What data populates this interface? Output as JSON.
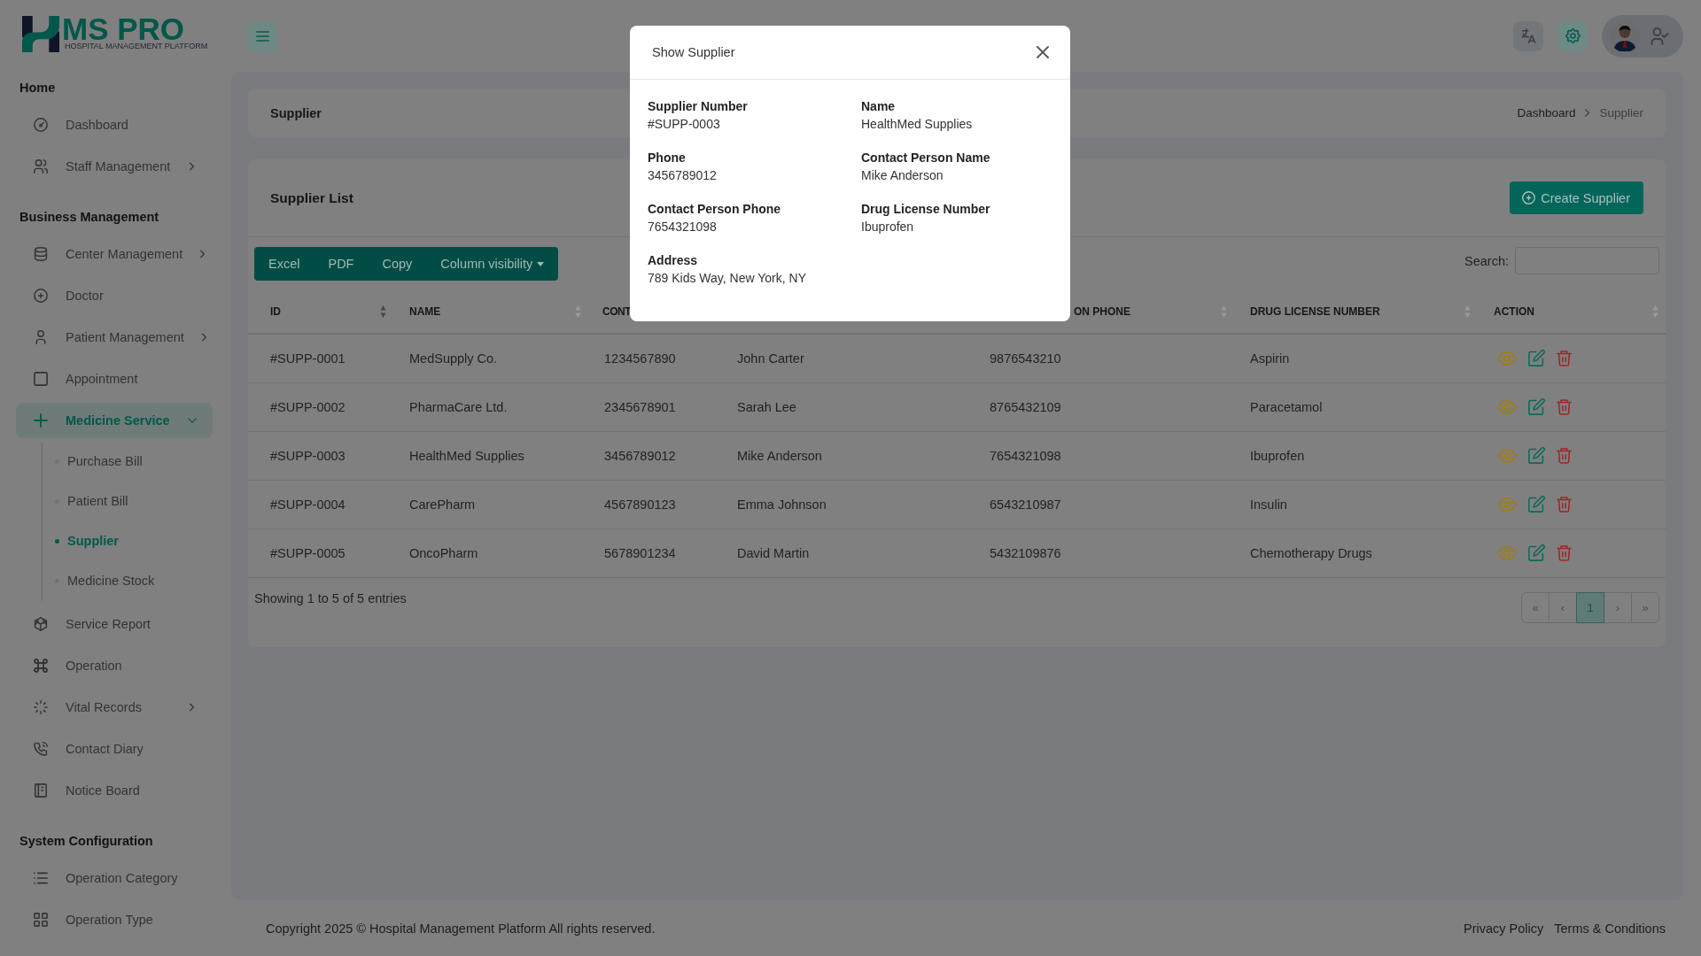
{
  "sidebar": {
    "logo": {
      "title": "MS PRO",
      "tagline": "HOSPITAL MANAGEMENT PLATFORM"
    },
    "sections": [
      {
        "title": "Home",
        "items": [
          {
            "label": "Dashboard",
            "kind": "link",
            "selected": false
          },
          {
            "label": "Staff Management",
            "kind": "menu",
            "expanded": false,
            "selected": false
          }
        ]
      },
      {
        "title": "Business Management",
        "items": [
          {
            "label": "Center Management",
            "kind": "menu",
            "expanded": false,
            "selected": false
          },
          {
            "label": "Doctor",
            "kind": "link",
            "selected": false
          },
          {
            "label": "Patient Management",
            "kind": "menu",
            "expanded": false,
            "selected": false
          },
          {
            "label": "Appointment",
            "kind": "link",
            "selected": false
          },
          {
            "label": "Medicine Service",
            "kind": "menu",
            "expanded": true,
            "selected": true,
            "children": [
              {
                "label": "Purchase Bill",
                "selected": false
              },
              {
                "label": "Patient Bill",
                "selected": false
              },
              {
                "label": "Supplier",
                "selected": true
              },
              {
                "label": "Medicine Stock",
                "selected": false
              }
            ]
          },
          {
            "label": "Service Report",
            "kind": "link",
            "selected": false
          },
          {
            "label": "Operation",
            "kind": "link",
            "selected": false
          },
          {
            "label": "Vital Records",
            "kind": "menu",
            "expanded": false,
            "selected": false
          },
          {
            "label": "Contact Diary",
            "kind": "link",
            "selected": false
          },
          {
            "label": "Notice Board",
            "kind": "link",
            "selected": false
          }
        ]
      },
      {
        "title": "System Configuration",
        "items": [
          {
            "label": "Operation Category",
            "kind": "link",
            "selected": false
          },
          {
            "label": "Operation Type",
            "kind": "link",
            "selected": false
          }
        ]
      }
    ]
  },
  "page_header": {
    "title": "Supplier",
    "breadcrumb": [
      {
        "label": "Dashboard",
        "selected": false
      },
      {
        "label": "Supplier",
        "selected": true
      }
    ]
  },
  "supplier_list": {
    "title": "Supplier List",
    "create_button": "Create Supplier",
    "export_buttons": [
      {
        "label": "Excel",
        "kind": "button"
      },
      {
        "label": "PDF",
        "kind": "button"
      },
      {
        "label": "Copy",
        "kind": "button"
      },
      {
        "label": "Column visibility",
        "kind": "dropdown"
      }
    ],
    "search": {
      "label": "Search:"
    },
    "table": {
      "columns": [
        {
          "label": "ID",
          "kind": "text",
          "sorted": true
        },
        {
          "label": "NAME",
          "kind": "text",
          "sorted": false
        },
        {
          "label": "CONT",
          "kind": "text"
        },
        {
          "kind": "text"
        },
        {
          "label": "ON PHONE",
          "kind": "text",
          "sorted": false
        },
        {
          "label": "DRUG LICENSE NUMBER",
          "kind": "text",
          "sorted": false
        },
        {
          "label": "ACTION",
          "kind": "actions",
          "sorted": false
        }
      ],
      "rows": [
        [
          "#SUPP-0001",
          "MedSupply Co.",
          "1234567890",
          "John Carter",
          "9876543210",
          "Aspirin"
        ],
        [
          "#SUPP-0002",
          "PharmaCare Ltd.",
          "2345678901",
          "Sarah Lee",
          "8765432109",
          "Paracetamol"
        ],
        [
          "#SUPP-0003",
          "HealthMed Supplies",
          "3456789012",
          "Mike Anderson",
          "7654321098",
          "Ibuprofen"
        ],
        [
          "#SUPP-0004",
          "CarePharm",
          "4567890123",
          "Emma Johnson",
          "6543210987",
          "Insulin"
        ],
        [
          "#SUPP-0005",
          "OncoPharm",
          "5678901234",
          "David Martin",
          "5432109876",
          "Chemotherapy Drugs"
        ]
      ]
    },
    "info": "Showing 1 to 5 of 5 entries",
    "pagination": [
      {
        "label": "«",
        "selected": false
      },
      {
        "label": "‹",
        "selected": false
      },
      {
        "label": "1",
        "selected": true
      },
      {
        "label": "›",
        "selected": false
      },
      {
        "label": "»",
        "selected": false
      }
    ]
  },
  "footer": {
    "copyright": "Copyright 2025 © Hospital Management Platform All rights reserved.",
    "links": [
      "Privacy Policy",
      "Terms & Conditions"
    ]
  },
  "modal": {
    "title": "Show Supplier",
    "fields": [
      {
        "label": "Supplier Number",
        "value": "#SUPP-0003"
      },
      {
        "label": "Name",
        "value": "HealthMed Supplies"
      },
      {
        "label": "Phone",
        "value": "3456789012"
      },
      {
        "label": "Contact Person Name",
        "value": "Mike Anderson"
      },
      {
        "label": "Contact Person Phone",
        "value": "7654321098"
      },
      {
        "label": "Drug License Number",
        "value": "Ibuprofen"
      },
      {
        "label": "Address",
        "value": "789 Kids Way, New York, NY"
      }
    ]
  }
}
